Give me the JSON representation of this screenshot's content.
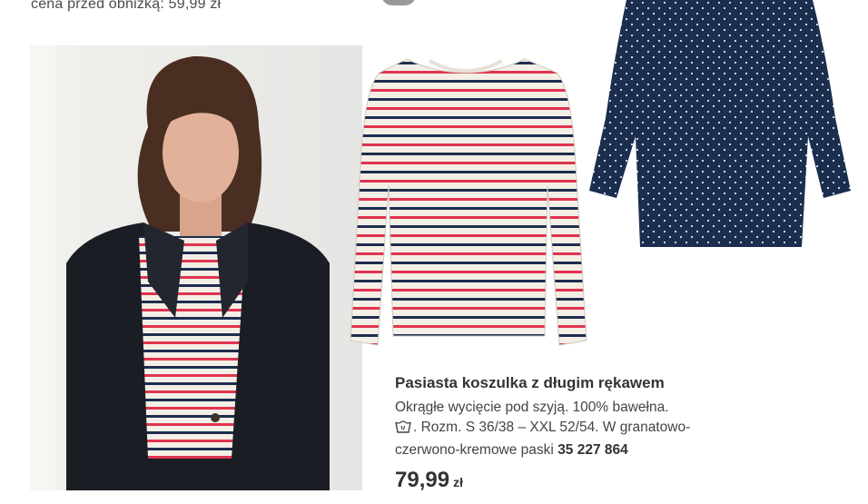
{
  "header": {
    "previous_price_text": "cena przed obniżką: 59,99 zł"
  },
  "product": {
    "title": "Pasiasta koszulka z długim rękawem",
    "desc_line1": "Okrągłe wycięcie pod szyją. 100% bawełna.",
    "desc_line2": ". Rozm. S 36/38 – XXL 52/54. W granatowo-",
    "desc_line3_text": "czerwono-kremowe paski",
    "article_number": "35 227 864",
    "price": "79,99",
    "currency": "zł"
  },
  "icons": {
    "wash": "washing-symbol-icon"
  },
  "colors": {
    "stripe_red": "#e0344f",
    "stripe_navy": "#1e2d4f",
    "stripe_cream": "#f3efe6",
    "dot_navy": "#1b2e4e",
    "blazer": "#1b1d24"
  }
}
